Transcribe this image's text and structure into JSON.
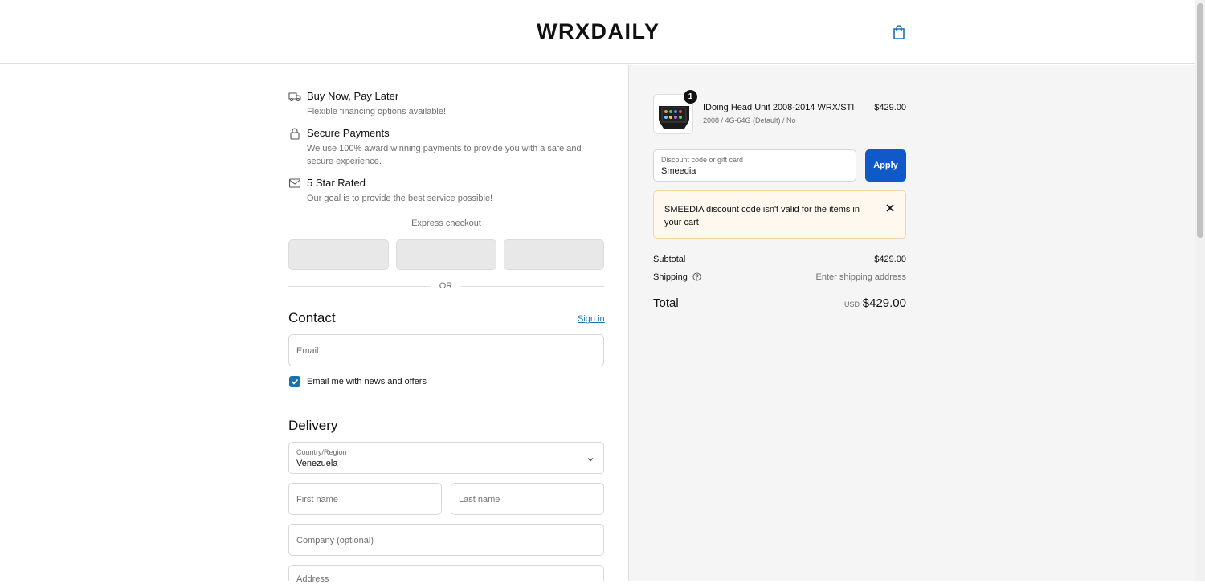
{
  "header": {
    "brand": "WRXDAILY",
    "cart_icon": "shopping-bag-icon"
  },
  "features": [
    {
      "icon": "truck-icon",
      "title": "Buy Now, Pay Later",
      "description": "Flexible financing options available!"
    },
    {
      "icon": "lock-icon",
      "title": "Secure Payments",
      "description": "We use 100% award winning payments to provide you with a safe and secure experience."
    },
    {
      "icon": "mail-icon",
      "title": "5 Star Rated",
      "description": "Our goal is to provide the best service possible!"
    }
  ],
  "express": {
    "label": "Express checkout",
    "or": "OR"
  },
  "contact": {
    "title": "Contact",
    "signin": "Sign in",
    "email_placeholder": "Email",
    "newsletter_label": "Email me with news and offers",
    "newsletter_checked": true
  },
  "delivery": {
    "title": "Delivery",
    "country_label": "Country/Region",
    "country_value": "Venezuela",
    "first_name": "First name",
    "last_name": "Last name",
    "company": "Company (optional)",
    "address": "Address"
  },
  "summary": {
    "item": {
      "quantity": "1",
      "name": "IDoing Head Unit 2008-2014 WRX/STI",
      "variant": "2008 / 4G-64G (Default) / No",
      "price": "$429.00"
    },
    "discount_label": "Discount code or gift card",
    "discount_value": "Smeedia",
    "apply": "Apply",
    "alert_code": "SMEEDIA",
    "alert_text": " discount code isn't valid for the items in your cart",
    "subtotal_label": "Subtotal",
    "subtotal_value": "$429.00",
    "shipping_label": "Shipping",
    "shipping_value": "Enter shipping address",
    "total_label": "Total",
    "total_currency": "USD",
    "total_value": "$429.00"
  }
}
